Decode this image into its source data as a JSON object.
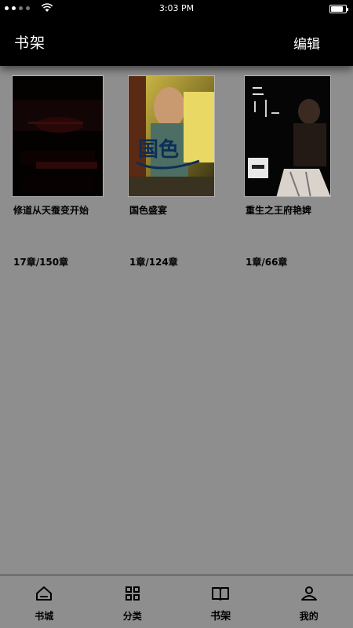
{
  "status_bar": {
    "carrier": "",
    "time": "3:03 PM",
    "battery_level": 0.85
  },
  "nav": {
    "title": "书架",
    "edit_label": "编辑"
  },
  "books": [
    {
      "title": "修道从天蚕变开始",
      "progress": "17章/150章",
      "cover_theme": "dark-red"
    },
    {
      "title": "国色盛宴",
      "progress": "1章/124章",
      "cover_theme": "photo-yellow"
    },
    {
      "title": "重生之王府艳婢",
      "progress": "1章/66章",
      "cover_theme": "dark-figure"
    }
  ],
  "tabs": [
    {
      "label": "书城",
      "icon": "home-icon",
      "active": false
    },
    {
      "label": "分类",
      "icon": "grid-icon",
      "active": false
    },
    {
      "label": "书架",
      "icon": "book-open-icon",
      "active": true
    },
    {
      "label": "我的",
      "icon": "person-icon",
      "active": false
    }
  ],
  "colors": {
    "background": "#8e8e8e",
    "bar": "#000000",
    "text": "#000000"
  }
}
